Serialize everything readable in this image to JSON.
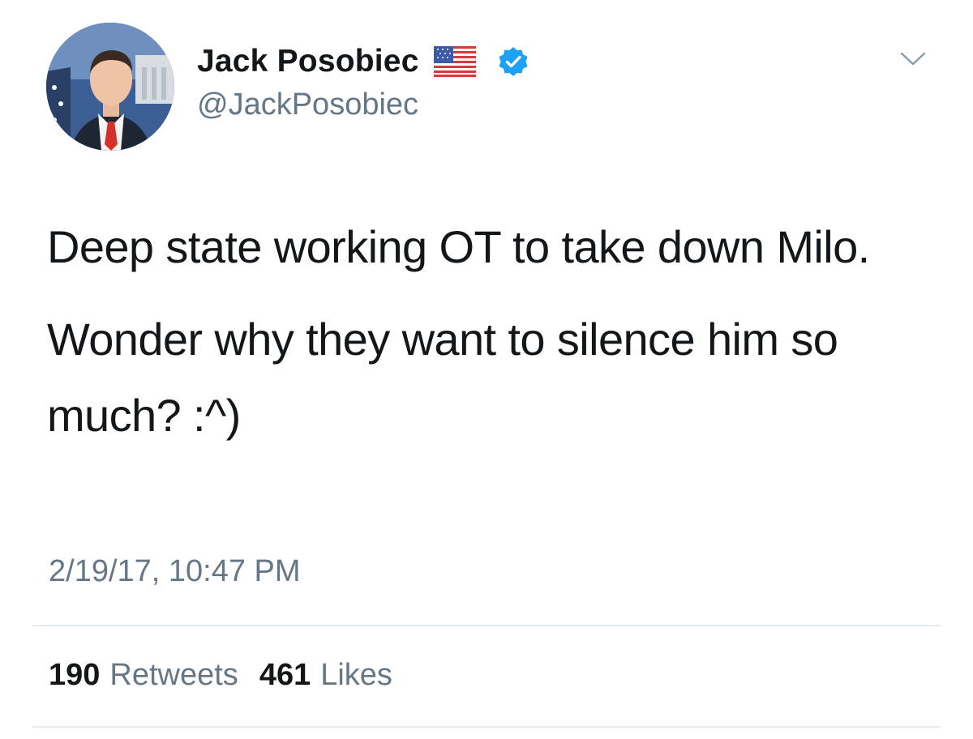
{
  "author": {
    "display_name": "Jack Posobiec",
    "handle": "@JackPosobiec",
    "avatar_icon": "profile-photo",
    "flag_icon": "us-flag-emoji",
    "verified_icon": "verified-badge-icon"
  },
  "menu": {
    "icon": "chevron-down-icon"
  },
  "tweet": {
    "paragraphs": [
      "Deep state working OT to take down Milo.",
      "Wonder why they want to silence him so much? :^)"
    ],
    "timestamp": "2/19/17, 10:47 PM"
  },
  "stats": {
    "retweets_count": "190",
    "retweets_label": "Retweets",
    "likes_count": "461",
    "likes_label": "Likes"
  },
  "colors": {
    "text": "#14171a",
    "secondary": "#657786",
    "verified_blue": "#1da1f2",
    "divider": "#e6ecf0"
  }
}
